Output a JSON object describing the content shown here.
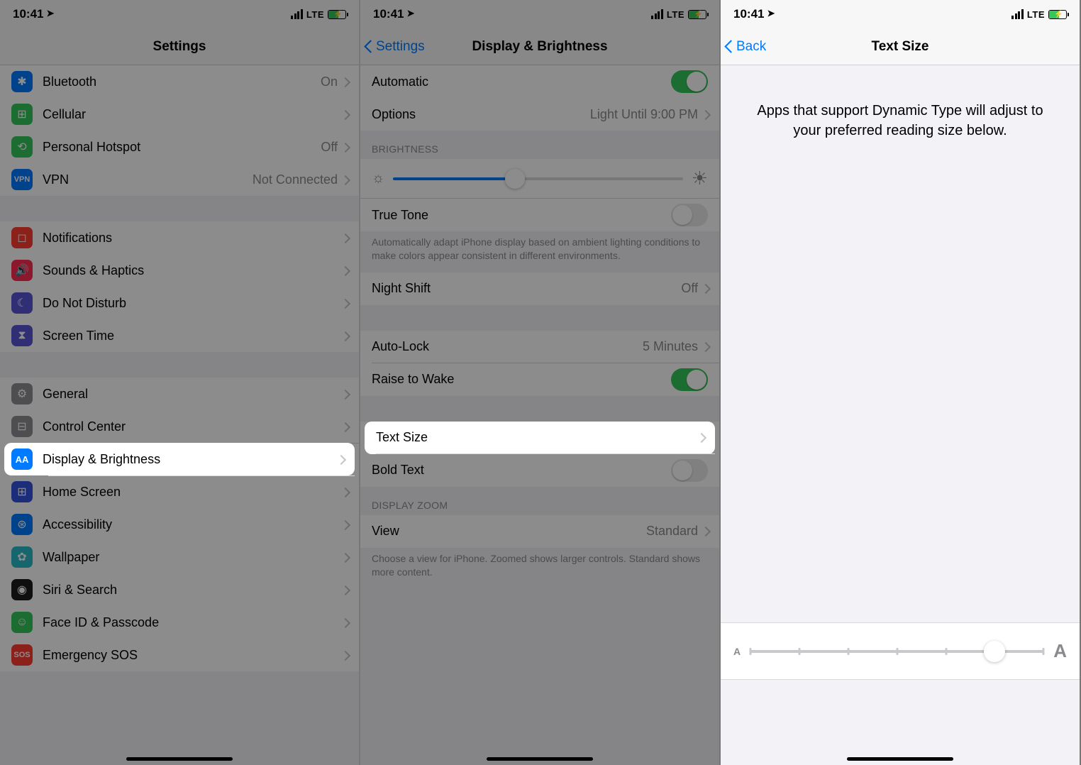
{
  "status": {
    "time": "10:41",
    "network": "LTE"
  },
  "screen1": {
    "title": "Settings",
    "rows": {
      "bluetooth": {
        "label": "Bluetooth",
        "value": "On"
      },
      "cellular": {
        "label": "Cellular"
      },
      "hotspot": {
        "label": "Personal Hotspot",
        "value": "Off"
      },
      "vpn": {
        "label": "VPN",
        "value": "Not Connected"
      },
      "notifications": {
        "label": "Notifications"
      },
      "sounds": {
        "label": "Sounds & Haptics"
      },
      "dnd": {
        "label": "Do Not Disturb"
      },
      "screentime": {
        "label": "Screen Time"
      },
      "general": {
        "label": "General"
      },
      "control": {
        "label": "Control Center"
      },
      "display": {
        "label": "Display & Brightness"
      },
      "home": {
        "label": "Home Screen"
      },
      "accessibility": {
        "label": "Accessibility"
      },
      "wallpaper": {
        "label": "Wallpaper"
      },
      "siri": {
        "label": "Siri & Search"
      },
      "faceid": {
        "label": "Face ID & Passcode"
      },
      "sos": {
        "label": "Emergency SOS"
      }
    }
  },
  "screen2": {
    "back": "Settings",
    "title": "Display & Brightness",
    "rows": {
      "automatic": {
        "label": "Automatic"
      },
      "options": {
        "label": "Options",
        "value": "Light Until 9:00 PM"
      },
      "brightness_header": "BRIGHTNESS",
      "truetone": {
        "label": "True Tone"
      },
      "truetone_footer": "Automatically adapt iPhone display based on ambient lighting conditions to make colors appear consistent in different environments.",
      "nightshift": {
        "label": "Night Shift",
        "value": "Off"
      },
      "autolock": {
        "label": "Auto-Lock",
        "value": "5 Minutes"
      },
      "raise": {
        "label": "Raise to Wake"
      },
      "textsize": {
        "label": "Text Size"
      },
      "boldtext": {
        "label": "Bold Text"
      },
      "zoom_header": "DISPLAY ZOOM",
      "view": {
        "label": "View",
        "value": "Standard"
      },
      "zoom_footer": "Choose a view for iPhone. Zoomed shows larger controls. Standard shows more content."
    }
  },
  "screen3": {
    "back": "Back",
    "title": "Text Size",
    "explain": "Apps that support Dynamic Type will adjust to your preferred reading size below.",
    "slider": {
      "small": "A",
      "large": "A",
      "steps": 7,
      "value": 5
    }
  }
}
